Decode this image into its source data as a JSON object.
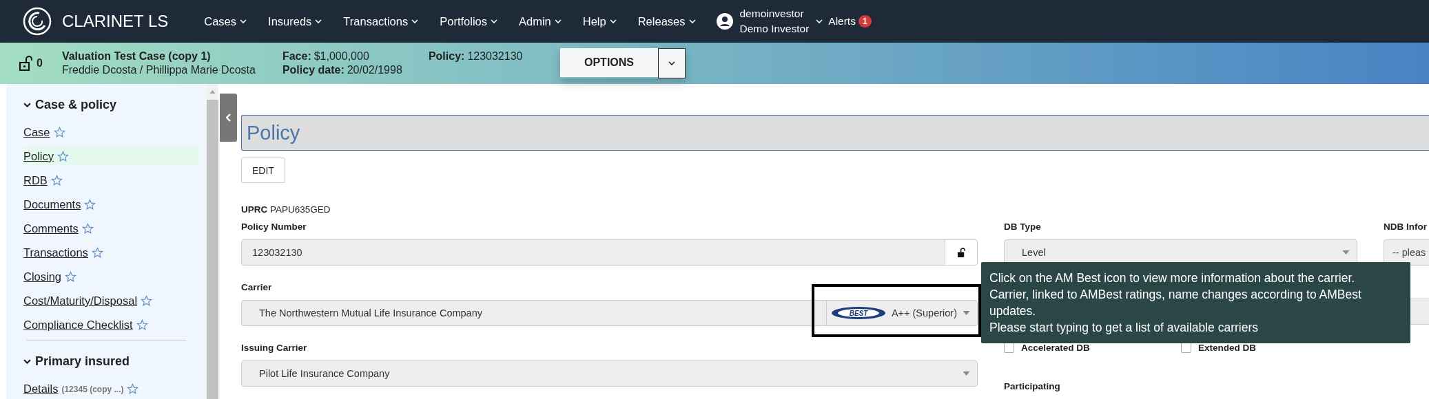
{
  "app": {
    "name": "CLARINET LS"
  },
  "nav": [
    {
      "label": "Cases"
    },
    {
      "label": "Insureds"
    },
    {
      "label": "Transactions"
    },
    {
      "label": "Portfolios"
    },
    {
      "label": "Admin"
    },
    {
      "label": "Help"
    },
    {
      "label": "Releases"
    }
  ],
  "user": {
    "username": "demoinvestor",
    "display_name": "Demo Investor"
  },
  "alerts": {
    "label": "Alerts",
    "count": "1"
  },
  "case_header": {
    "lock_count": "0",
    "title": "Valuation Test Case (copy 1)",
    "insureds": "Freddie Dcosta / Phillippa Marie Dcosta",
    "facts": [
      {
        "label": "Face:",
        "value": "$1,000,000"
      },
      {
        "label": "Policy date:",
        "value": "20/02/1998"
      },
      {
        "label": "Policy:",
        "value": "123032130"
      }
    ],
    "options_button": "OPTIONS"
  },
  "sidebar": {
    "sections": [
      {
        "title": "Case & policy",
        "expanded": true,
        "items": [
          {
            "label": "Case",
            "selected": false
          },
          {
            "label": "Policy",
            "selected": true
          },
          {
            "label": "RDB",
            "selected": false
          },
          {
            "label": "Documents",
            "selected": false
          },
          {
            "label": "Comments",
            "selected": false
          },
          {
            "label": "Transactions",
            "selected": false
          },
          {
            "label": "Closing",
            "selected": false
          },
          {
            "label": "Cost/Maturity/Disposal",
            "selected": false
          },
          {
            "label": "Compliance Checklist",
            "selected": false
          }
        ]
      },
      {
        "title": "Primary insured",
        "expanded": true,
        "items": [
          {
            "label": "Details",
            "detail": "(12345 (copy ...)",
            "selected": false
          }
        ]
      }
    ]
  },
  "page": {
    "title": "Policy",
    "edit_button": "EDIT",
    "uprc": {
      "label": "UPRC",
      "value": "PAPU635GED"
    },
    "policy_number": {
      "label": "Policy Number",
      "value": "123032130"
    },
    "carrier": {
      "label": "Carrier",
      "value": "The Northwestern Mutual Life Insurance Company",
      "logo_text": "BEST",
      "rating": "A++ (Superior)"
    },
    "issuing_carrier": {
      "label": "Issuing Carrier",
      "value": "Pilot Life Insurance Company"
    },
    "db_type": {
      "label": "DB Type",
      "value": "Level"
    },
    "checkboxes": [
      {
        "label": "Accelerated DB",
        "checked": false
      },
      {
        "label": "Extended DB",
        "checked": false
      }
    ],
    "participating": {
      "label": "Participating"
    },
    "ndb": {
      "label": "NDB Infor",
      "placeholder": "-- pleas"
    },
    "tooltip": {
      "lines": [
        "Click on the AM Best icon to view more information about the carrier.",
        "Carrier, linked to AMBest ratings, name changes according to AMBest updates.",
        "Please start typing to get a list of available carriers"
      ]
    }
  }
}
